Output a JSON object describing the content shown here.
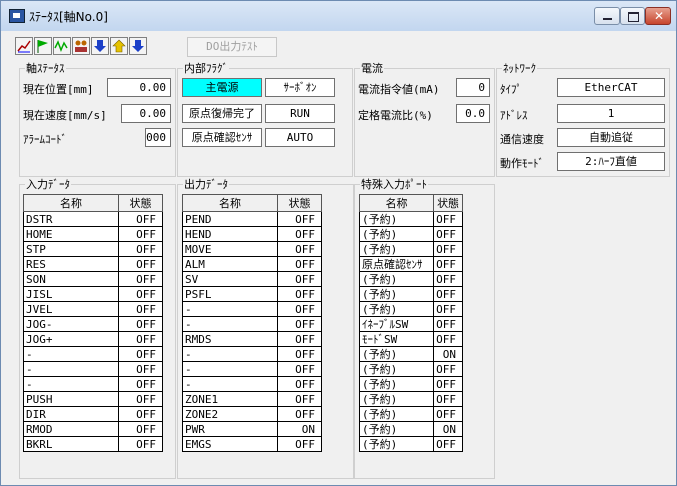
{
  "window": {
    "title": "ｽﾃｰﾀｽ[軸No.0]"
  },
  "toolbar": {
    "do_output_test": "DO出力ﾃｽﾄ"
  },
  "axis_status": {
    "legend": "軸ｽﾃｰﾀｽ",
    "pos_label": "現在位置[mm]",
    "pos_value": "0.00",
    "speed_label": "現在速度[mm/s]",
    "speed_value": "0.00",
    "alarm_label": "ｱﾗｰﾑｺｰﾄﾞ",
    "alarm_value": "000"
  },
  "internal_flags": {
    "legend": "内部ﾌﾗｸﾞ",
    "main_power": "主電源",
    "servo_on": "ｻｰﾎﾞｵﾝ",
    "home_done": "原点復帰完了",
    "run": "RUN",
    "home_sensor": "原点確認ｾﾝｻ",
    "auto": "AUTO"
  },
  "current": {
    "legend": "電流",
    "cmd_label": "電流指令値(mA)",
    "cmd_value": "0",
    "ratio_label": "定格電流比(%)",
    "ratio_value": "0.0"
  },
  "network": {
    "legend": "ﾈｯﾄﾜｰｸ",
    "type_label": "ﾀｲﾌﾟ",
    "type_value": "EtherCAT",
    "addr_label": "ｱﾄﾞﾚｽ",
    "addr_value": "1",
    "speed_label": "通信速度",
    "speed_value": "自動追従",
    "mode_label": "動作ﾓｰﾄﾞ",
    "mode_value": "2:ﾊｰﾌ直値"
  },
  "input_data": {
    "legend": "入力ﾃﾞｰﾀ",
    "col_name": "名称",
    "col_state": "状態",
    "rows": [
      [
        "DSTR",
        "OFF"
      ],
      [
        "HOME",
        "OFF"
      ],
      [
        "STP",
        "OFF"
      ],
      [
        "RES",
        "OFF"
      ],
      [
        "SON",
        "OFF"
      ],
      [
        "JISL",
        "OFF"
      ],
      [
        "JVEL",
        "OFF"
      ],
      [
        "JOG-",
        "OFF"
      ],
      [
        "JOG+",
        "OFF"
      ],
      [
        "-",
        "OFF"
      ],
      [
        "-",
        "OFF"
      ],
      [
        "-",
        "OFF"
      ],
      [
        "PUSH",
        "OFF"
      ],
      [
        "DIR",
        "OFF"
      ],
      [
        "RMOD",
        "OFF"
      ],
      [
        "BKRL",
        "OFF"
      ]
    ]
  },
  "output_data": {
    "legend": "出力ﾃﾞｰﾀ",
    "col_name": "名称",
    "col_state": "状態",
    "rows": [
      [
        "PEND",
        "OFF"
      ],
      [
        "HEND",
        "OFF"
      ],
      [
        "MOVE",
        "OFF"
      ],
      [
        "ALM",
        "OFF"
      ],
      [
        "SV",
        "OFF"
      ],
      [
        "PSFL",
        "OFF"
      ],
      [
        "-",
        "OFF"
      ],
      [
        "-",
        "OFF"
      ],
      [
        "RMDS",
        "OFF"
      ],
      [
        "-",
        "OFF"
      ],
      [
        "-",
        "OFF"
      ],
      [
        "-",
        "OFF"
      ],
      [
        "ZONE1",
        "OFF"
      ],
      [
        "ZONE2",
        "OFF"
      ],
      [
        "PWR",
        "ON"
      ],
      [
        "EMGS",
        "OFF"
      ]
    ]
  },
  "special_input": {
    "legend": "特殊入力ﾎﾟｰﾄ",
    "col_name": "名称",
    "col_state": "状態",
    "rows": [
      [
        "(予約)",
        "OFF"
      ],
      [
        "(予約)",
        "OFF"
      ],
      [
        "(予約)",
        "OFF"
      ],
      [
        "原点確認ｾﾝｻ",
        "OFF"
      ],
      [
        "(予約)",
        "OFF"
      ],
      [
        "(予約)",
        "OFF"
      ],
      [
        "(予約)",
        "OFF"
      ],
      [
        "ｲﾈｰﾌﾞﾙSW",
        "OFF"
      ],
      [
        "ﾓｰﾄﾞSW",
        "OFF"
      ],
      [
        "(予約)",
        "ON"
      ],
      [
        "(予約)",
        "OFF"
      ],
      [
        "(予約)",
        "OFF"
      ],
      [
        "(予約)",
        "OFF"
      ],
      [
        "(予約)",
        "OFF"
      ],
      [
        "(予約)",
        "ON"
      ],
      [
        "(予約)",
        "OFF"
      ]
    ]
  },
  "colors": {
    "lamp_on": "#00ffff",
    "titlebar": "#c2d6ef"
  },
  "icons": [
    "graph-icon",
    "flag-icon",
    "waveform-icon",
    "network-icon",
    "arrow-down-icon",
    "arrow-up-icon",
    "arrow-down-icon"
  ]
}
